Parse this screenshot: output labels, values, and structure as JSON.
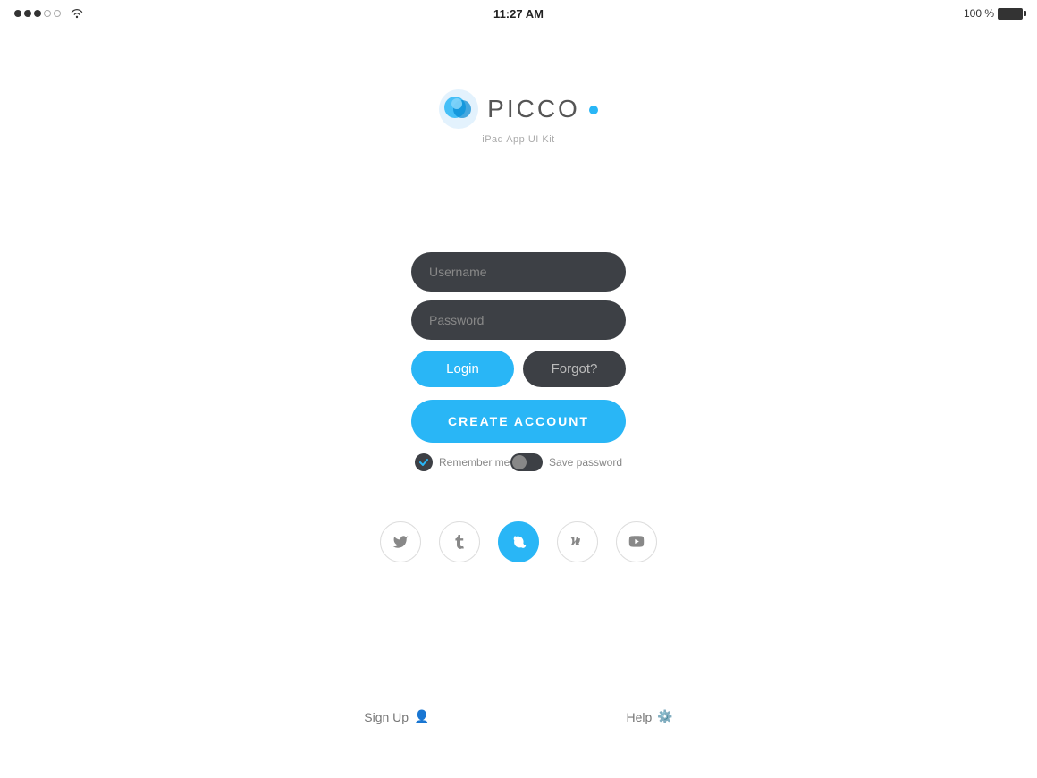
{
  "statusBar": {
    "time": "11:27 AM",
    "batteryPercent": "100 %",
    "signalDots": [
      true,
      true,
      true,
      false,
      false
    ]
  },
  "logo": {
    "appName": "PICCO",
    "subtitle": "iPad App UI Kit"
  },
  "form": {
    "usernamePlaceholder": "Username",
    "passwordPlaceholder": "Password",
    "loginLabel": "Login",
    "forgotLabel": "Forgot?",
    "createAccountLabel": "CREATE ACCOUNT"
  },
  "checkboxes": {
    "rememberMe": "Remember me",
    "savePassword": "Save password"
  },
  "social": [
    {
      "id": "twitter",
      "symbol": "𝕋",
      "active": false
    },
    {
      "id": "tumblr",
      "symbol": "t",
      "active": false
    },
    {
      "id": "skype",
      "symbol": "S",
      "active": true
    },
    {
      "id": "vk",
      "symbol": "ВК",
      "active": false
    },
    {
      "id": "youtube",
      "symbol": "▶",
      "active": false
    }
  ],
  "bottomLinks": {
    "signUp": "Sign Up",
    "help": "Help"
  },
  "colors": {
    "accent": "#29b6f6",
    "inputBg": "#3d4045",
    "inputText": "#888"
  }
}
